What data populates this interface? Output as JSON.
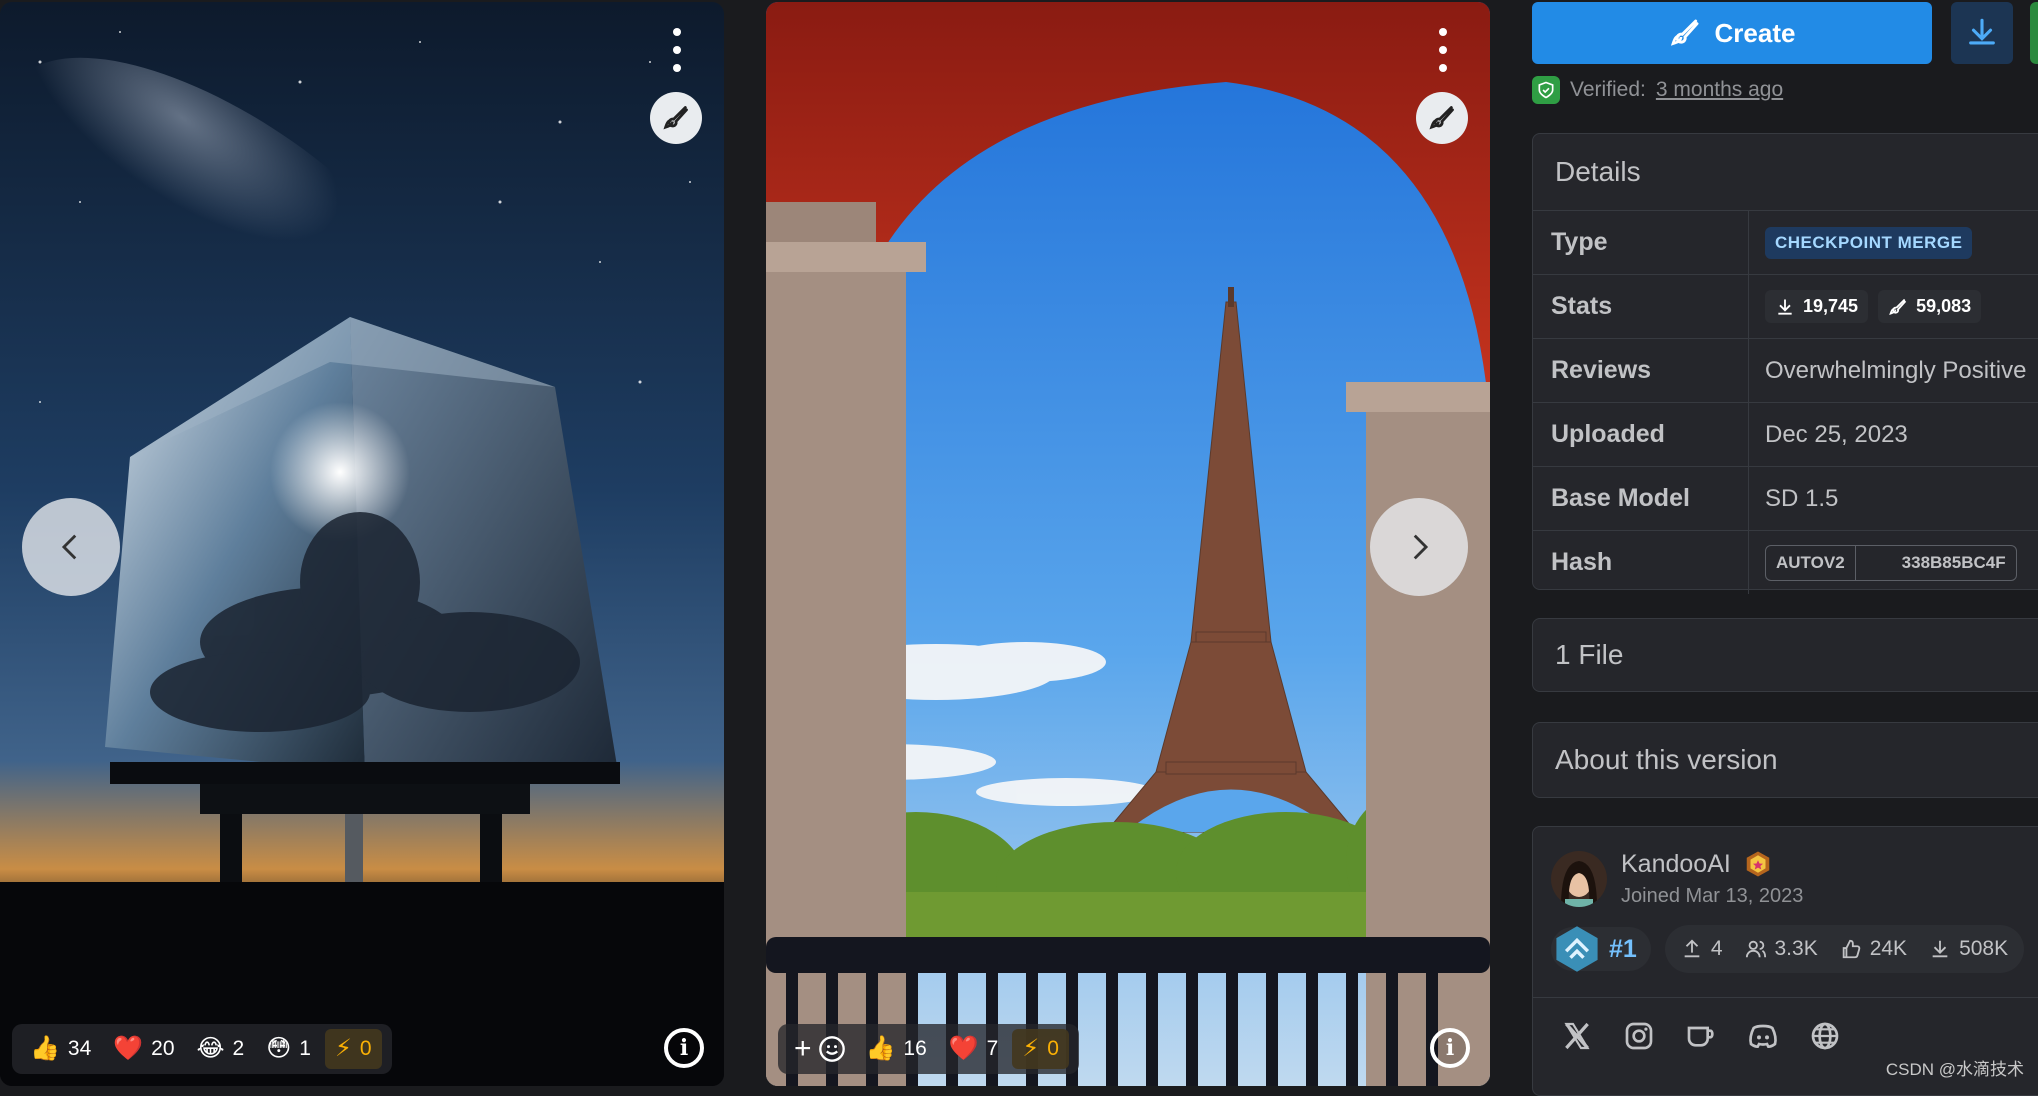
{
  "card1": {
    "reactions": {
      "like": "34",
      "heart": "20",
      "laugh": "2",
      "cry": "1",
      "buzz": "0"
    },
    "like_emoji": "👍",
    "heart_emoji": "❤️",
    "laugh_emoji": "😂",
    "cry_emoji": "😳",
    "buzz_icon": "⚡"
  },
  "card2": {
    "add_reaction": "+",
    "reactions": {
      "like": "16",
      "heart": "7",
      "buzz": "0"
    },
    "like_emoji": "👍",
    "heart_emoji": "❤️",
    "buzz_icon": "⚡"
  },
  "info_glyph": "i",
  "actions": {
    "create_label": "Create"
  },
  "verified": {
    "label": "Verified:",
    "time": "3 months ago"
  },
  "details": {
    "title": "Details",
    "rows": [
      {
        "key": "Type",
        "value": "CHECKPOINT MERGE"
      },
      {
        "key": "Stats",
        "downloads": "19,745",
        "generations": "59,083"
      },
      {
        "key": "Reviews",
        "value": "Overwhelmingly Positive"
      },
      {
        "key": "Uploaded",
        "value": "Dec 25, 2023"
      },
      {
        "key": "Base Model",
        "value": "SD 1.5"
      },
      {
        "key": "Hash",
        "algo": "AUTOV2",
        "value": "338B85BC4F"
      }
    ]
  },
  "files": {
    "title": "1 File"
  },
  "about": {
    "title": "About this version"
  },
  "creator": {
    "name": "KandooAI",
    "joined": "Joined Mar 13, 2023",
    "rank": "#1",
    "uploads": "4",
    "followers": "3.3K",
    "likes": "24K",
    "downloads": "508K"
  },
  "watermark": "CSDN @水滴技术",
  "colors": {
    "accent": "#228be6",
    "positive": "#40c057",
    "panel": "#25262b",
    "background": "#1a1b1e"
  }
}
